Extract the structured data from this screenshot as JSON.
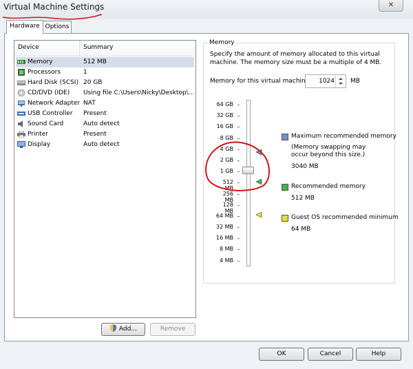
{
  "window": {
    "title": "Virtual Machine Settings",
    "close_label": "✕"
  },
  "tabs": [
    {
      "label": "Hardware"
    },
    {
      "label": "Options"
    }
  ],
  "device_list": {
    "headers": {
      "device": "Device",
      "summary": "Summary"
    },
    "rows": [
      {
        "name": "Memory",
        "summary": "512 MB",
        "icon": "memory-icon"
      },
      {
        "name": "Processors",
        "summary": "1",
        "icon": "processor-icon"
      },
      {
        "name": "Hard Disk (SCSI)",
        "summary": "20 GB",
        "icon": "hard-disk-icon"
      },
      {
        "name": "CD/DVD (IDE)",
        "summary": "Using file C:\\Users\\Nicky\\Desktop\\...",
        "icon": "cd-dvd-icon"
      },
      {
        "name": "Network Adapter",
        "summary": "NAT",
        "icon": "network-adapter-icon"
      },
      {
        "name": "USB Controller",
        "summary": "Present",
        "icon": "usb-icon"
      },
      {
        "name": "Sound Card",
        "summary": "Auto detect",
        "icon": "sound-card-icon"
      },
      {
        "name": "Printer",
        "summary": "Present",
        "icon": "printer-icon"
      },
      {
        "name": "Display",
        "summary": "Auto detect",
        "icon": "display-icon"
      }
    ],
    "selected_index": 0
  },
  "buttons": {
    "add": "Add...",
    "remove": "Remove",
    "ok": "OK",
    "cancel": "Cancel",
    "help": "Help"
  },
  "memory": {
    "group_title": "Memory",
    "description_line1": "Specify the amount of memory allocated to this virtual",
    "description_line2": "machine. The memory size must be a multiple of 4 MB.",
    "field_label": "Memory for this virtual machine:",
    "value": "1024",
    "unit": "MB",
    "scale": [
      "64 GB",
      "32 GB",
      "16 GB",
      "8 GB",
      "4 GB",
      "2 GB",
      "1 GB",
      "512 MB",
      "256 MB",
      "128 MB",
      "64 MB",
      "32 MB",
      "16 MB",
      "8 MB",
      "4 MB"
    ],
    "legend": {
      "max_title": "Maximum recommended memory",
      "max_note1": "(Memory swapping may",
      "max_note2": "occur beyond this size.)",
      "max_value": "3040 MB",
      "rec_title": "Recommended memory",
      "rec_value": "512 MB",
      "min_title": "Guest OS recommended minimum",
      "min_value": "64 MB"
    }
  },
  "colors": {
    "max_marker": "#6f8fc9",
    "rec_marker": "#3fb34f",
    "min_marker": "#e6d93a",
    "annotation": "#d0131a"
  }
}
